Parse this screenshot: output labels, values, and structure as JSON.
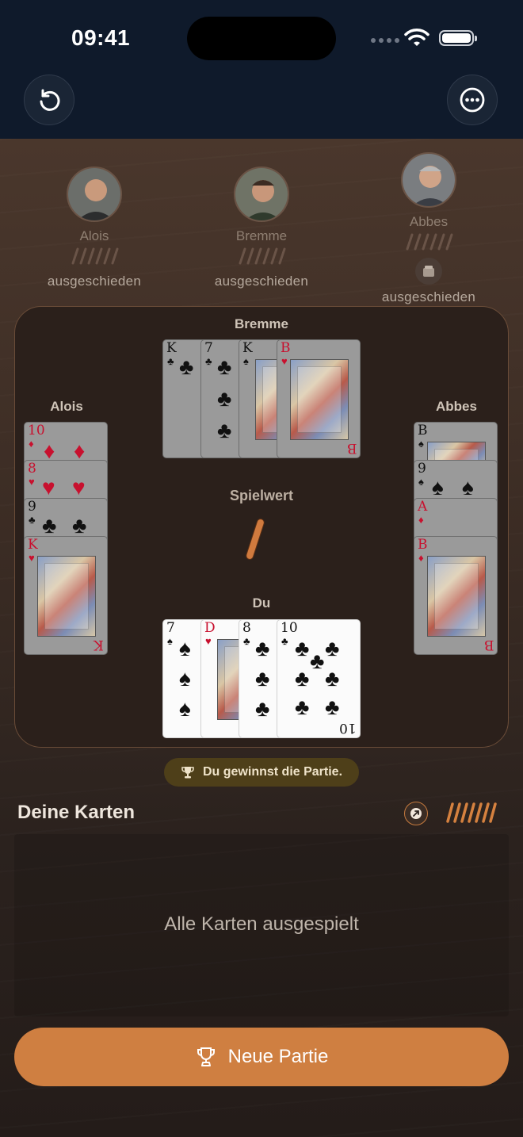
{
  "status_bar": {
    "time": "09:41"
  },
  "header": {
    "undo_icon": "undo-icon",
    "more_icon": "more-icon"
  },
  "opponents": [
    {
      "name": "Alois",
      "status": "ausgeschieden"
    },
    {
      "name": "Bremme",
      "status": "ausgeschieden"
    },
    {
      "name": "Abbes",
      "status": "ausgeschieden"
    }
  ],
  "table": {
    "top_label": "Bremme",
    "left_label": "Alois",
    "right_label": "Abbes",
    "bottom_label": "Du",
    "spielwert_label": "Spielwert",
    "spielwert_sticks": 1,
    "top_cards": [
      {
        "rank": "K",
        "suit": "♣",
        "color": "black"
      },
      {
        "rank": "7",
        "suit": "♣",
        "color": "black"
      },
      {
        "rank": "K",
        "suit": "♠",
        "color": "black"
      },
      {
        "rank": "B",
        "suit": "♥",
        "color": "red"
      }
    ],
    "left_cards": [
      {
        "rank": "10",
        "suit": "♦",
        "color": "red"
      },
      {
        "rank": "8",
        "suit": "♥",
        "color": "red"
      },
      {
        "rank": "9",
        "suit": "♣",
        "color": "black"
      },
      {
        "rank": "K",
        "suit": "♥",
        "color": "red"
      }
    ],
    "right_cards": [
      {
        "rank": "B",
        "suit": "♠",
        "color": "black"
      },
      {
        "rank": "9",
        "suit": "♠",
        "color": "black"
      },
      {
        "rank": "A",
        "suit": "♦",
        "color": "red"
      },
      {
        "rank": "B",
        "suit": "♦",
        "color": "red"
      }
    ],
    "my_cards": [
      {
        "rank": "7",
        "suit": "♠",
        "color": "black"
      },
      {
        "rank": "D",
        "suit": "♥",
        "color": "red"
      },
      {
        "rank": "8",
        "suit": "♣",
        "color": "black"
      },
      {
        "rank": "10",
        "suit": "♣",
        "color": "black"
      }
    ]
  },
  "result": {
    "text": "Du gewinnst die Partie.",
    "icon": "trophy-icon"
  },
  "hand": {
    "title": "Deine Karten",
    "tally_sticks": 7,
    "empty_message": "Alle Karten ausgespielt"
  },
  "new_game_button": {
    "label": "Neue Partie",
    "icon": "trophy-icon"
  },
  "colors": {
    "accent": "#cf7f41",
    "header_bg": "#0f1a2b",
    "pill_bg": "#4e3f19"
  }
}
